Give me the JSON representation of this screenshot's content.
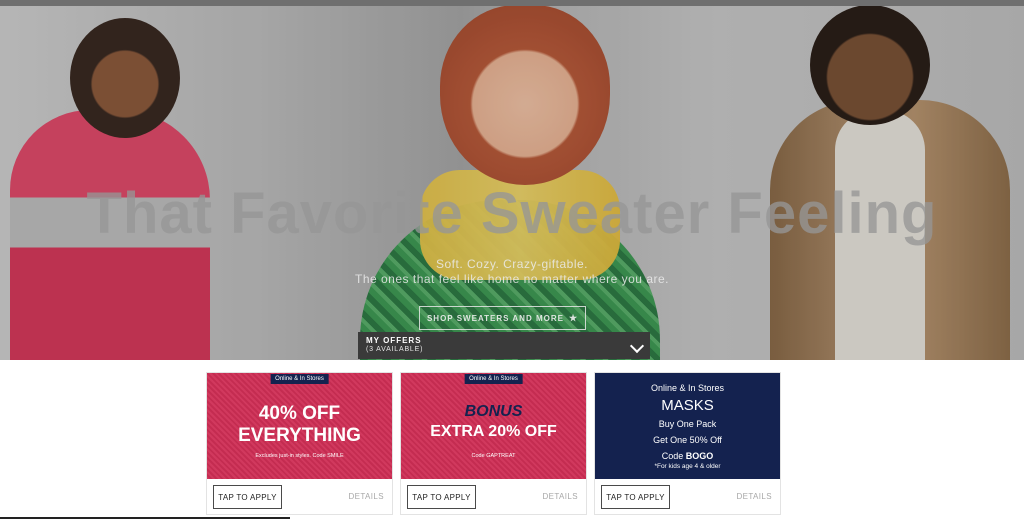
{
  "hero": {
    "headline": "That Favorite Sweater Feeling",
    "subline1": "Soft. Cozy. Crazy-giftable.",
    "subline2": "The ones that feel like home no matter where you are.",
    "cta_label": "SHOP SWEATERS AND MORE",
    "cta_icon": "star-icon"
  },
  "offers_bar": {
    "title": "MY OFFERS",
    "count": "(3 AVAILABLE)",
    "icon": "chevron-down-icon"
  },
  "offers": [
    {
      "badge": "Online & In Stores",
      "line1": "40% OFF",
      "line2": "EVERYTHING",
      "note": "Excludes just-in styles. Code SMILE",
      "apply_label": "TAP TO APPLY",
      "details_label": "DETAILS",
      "color": "#cf2e55"
    },
    {
      "badge": "Online & In Stores",
      "line1": "BONUS",
      "line2": "EXTRA 20% OFF",
      "note": "Code GAPTREAT",
      "apply_label": "TAP TO APPLY",
      "details_label": "DETAILS",
      "color": "#cf2e55"
    },
    {
      "badge": "Online & In Stores",
      "line1": "MASKS",
      "line2": "Buy One Pack",
      "line3": "Get One 50% Off",
      "code_prefix": "Code ",
      "code": "BOGO",
      "note": "*For kids age 4 & older",
      "apply_label": "TAP TO APPLY",
      "details_label": "DETAILS",
      "color": "#14224f"
    }
  ],
  "colors": {
    "brand_navy": "#14224f",
    "promo_red": "#cf2e55",
    "offers_bar": "#3a3a3a"
  }
}
